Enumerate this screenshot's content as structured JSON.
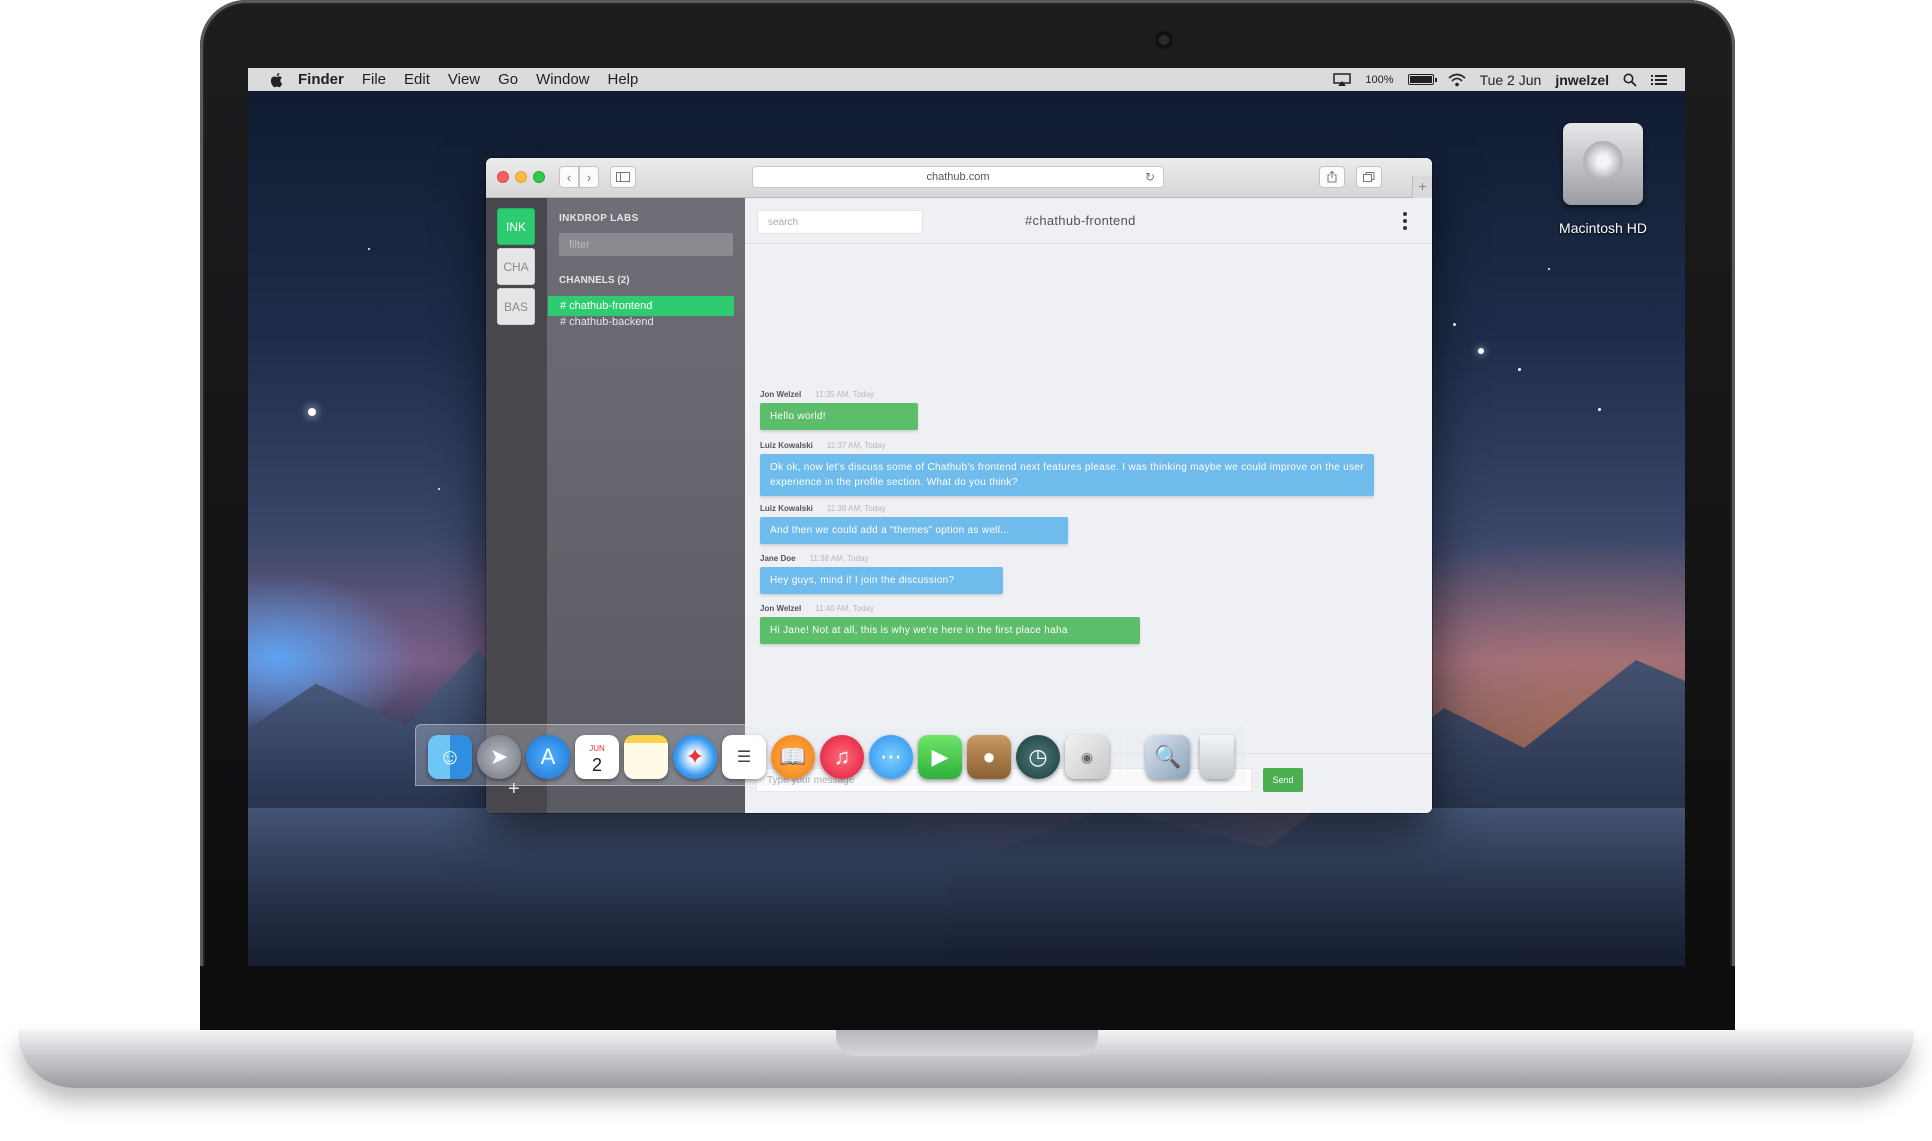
{
  "menubar": {
    "app_name": "Finder",
    "items": [
      "File",
      "Edit",
      "View",
      "Go",
      "Window",
      "Help"
    ],
    "battery_percent": "100%",
    "date": "Tue 2 Jun",
    "user": "jnwelzel"
  },
  "desktop": {
    "drive_label": "Macintosh HD"
  },
  "browser": {
    "url": "chathub.com"
  },
  "app": {
    "teams": [
      {
        "label": "INK",
        "active": true
      },
      {
        "label": "CHA",
        "active": false
      },
      {
        "label": "BAS",
        "active": false
      }
    ],
    "add_team": "+",
    "team_name": "INKDROP LABS",
    "filter_placeholder": "filter",
    "channels_heading": "CHANNELS (2)",
    "channels": [
      {
        "label": "# chathub-frontend",
        "active": true
      },
      {
        "label": "# chathub-backend",
        "active": false
      }
    ],
    "search_placeholder": "search",
    "channel_title": "#chathub-frontend",
    "messages": [
      {
        "author": "Jon Welzel",
        "time": "11:35 AM, Today",
        "text": "Hello world!",
        "color": "green"
      },
      {
        "author": "Luiz Kowalski",
        "time": "11:37 AM, Today",
        "text": "Ok ok, now let's discuss some of Chathub's frontend next features please. I was thinking maybe we could improve on the user experience in the profile section. What do you think?",
        "color": "blue"
      },
      {
        "author": "Luiz Kowalski",
        "time": "11:38 AM, Today",
        "text": "And then we could add a \"themes\" option as well...",
        "color": "blue"
      },
      {
        "author": "Jane Doe",
        "time": "11:38 AM, Today",
        "text": "Hey guys, mind if I join the discussion?",
        "color": "blue"
      },
      {
        "author": "Jon Welzel",
        "time": "11:40 AM, Today",
        "text": "Hi Jane! Not at all, this is why we're here in the first place haha",
        "color": "green"
      }
    ],
    "message_placeholder": "Type your message",
    "send_label": "Send"
  },
  "dock": {
    "apps": [
      "finder-icon",
      "launchpad-icon",
      "app-store-icon",
      "calendar-icon",
      "notes-icon",
      "safari-icon",
      "reminders-icon",
      "ibooks-icon",
      "itunes-icon",
      "messages-icon",
      "facetime-icon",
      "contacts-icon",
      "time-machine-icon",
      "photo-booth-icon",
      "preview-icon",
      "trash-icon"
    ],
    "calendar_month": "JUN",
    "calendar_day": "2"
  },
  "colors": {
    "accent_green": "#2ecc71",
    "bubble_green": "#5cbd6b",
    "bubble_blue": "#6fbbec",
    "rail": "#47474d",
    "sidebar": "#6e6f76"
  }
}
